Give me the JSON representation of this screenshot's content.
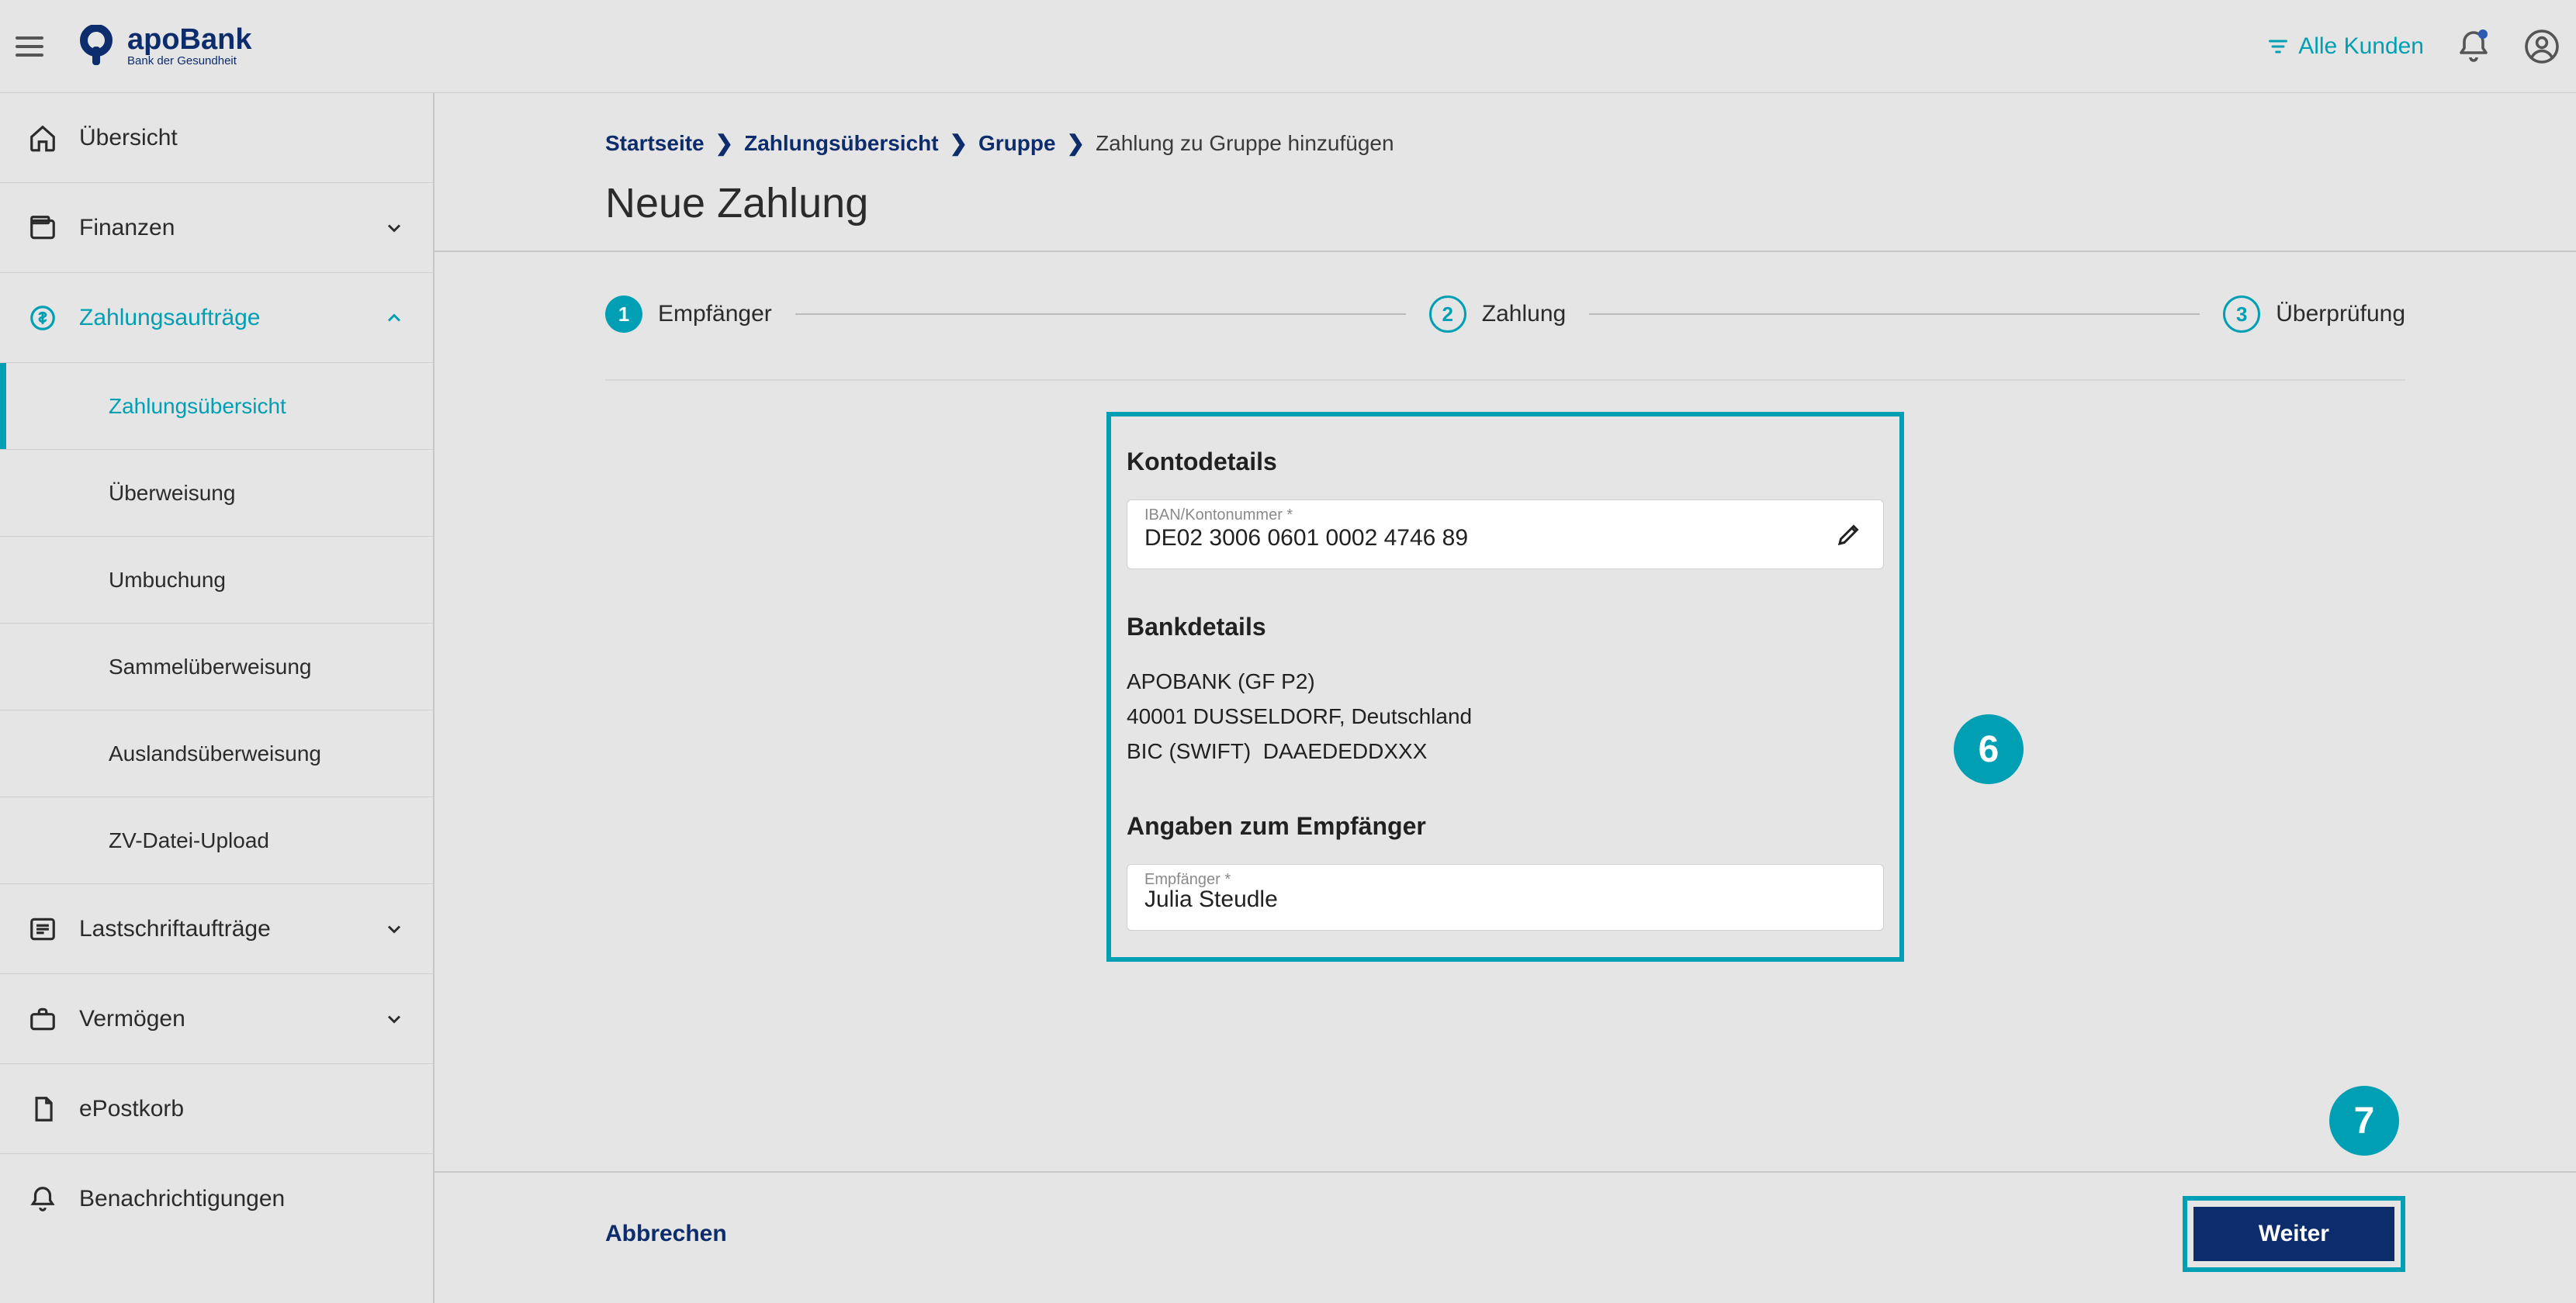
{
  "header": {
    "brand_main": "apoBank",
    "brand_sub": "Bank der Gesundheit",
    "filter_label": "Alle Kunden"
  },
  "sidebar": {
    "items": [
      {
        "label": "Übersicht"
      },
      {
        "label": "Finanzen"
      },
      {
        "label": "Zahlungsaufträge"
      },
      {
        "label": "Lastschriftaufträge"
      },
      {
        "label": "Vermögen"
      },
      {
        "label": "ePostkorb"
      },
      {
        "label": "Benachrichtigungen"
      }
    ],
    "sub_payments": [
      {
        "label": "Zahlungsübersicht"
      },
      {
        "label": "Überweisung"
      },
      {
        "label": "Umbuchung"
      },
      {
        "label": "Sammelüberweisung"
      },
      {
        "label": "Auslandsüberweisung"
      },
      {
        "label": "ZV-Datei-Upload"
      }
    ]
  },
  "breadcrumb": {
    "b0": "Startseite",
    "b1": "Zahlungsübersicht",
    "b2": "Gruppe",
    "b3": "Zahlung zu Gruppe hinzufügen"
  },
  "page_title": "Neue Zahlung",
  "stepper": {
    "s1_num": "1",
    "s1_label": "Empfänger",
    "s2_num": "2",
    "s2_label": "Zahlung",
    "s3_num": "3",
    "s3_label": "Überprüfung"
  },
  "form": {
    "section_konto": "Kontodetails",
    "iban_label": "IBAN/Kontonummer *",
    "iban_value": "DE02 3006 0601 0002 4746 89",
    "section_bank": "Bankdetails",
    "bank_name": "APOBANK (GF P2)",
    "bank_addr": "40001 DUSSELDORF, Deutschland",
    "bic_label": "BIC (SWIFT)",
    "bic_value": "DAAEDEDDXXX",
    "section_empf": "Angaben zum Empfänger",
    "empf_label": "Empfänger *",
    "empf_value": "Julia Steudle"
  },
  "callouts": {
    "c6": "6",
    "c7": "7"
  },
  "footer": {
    "cancel": "Abbrechen",
    "next": "Weiter"
  }
}
